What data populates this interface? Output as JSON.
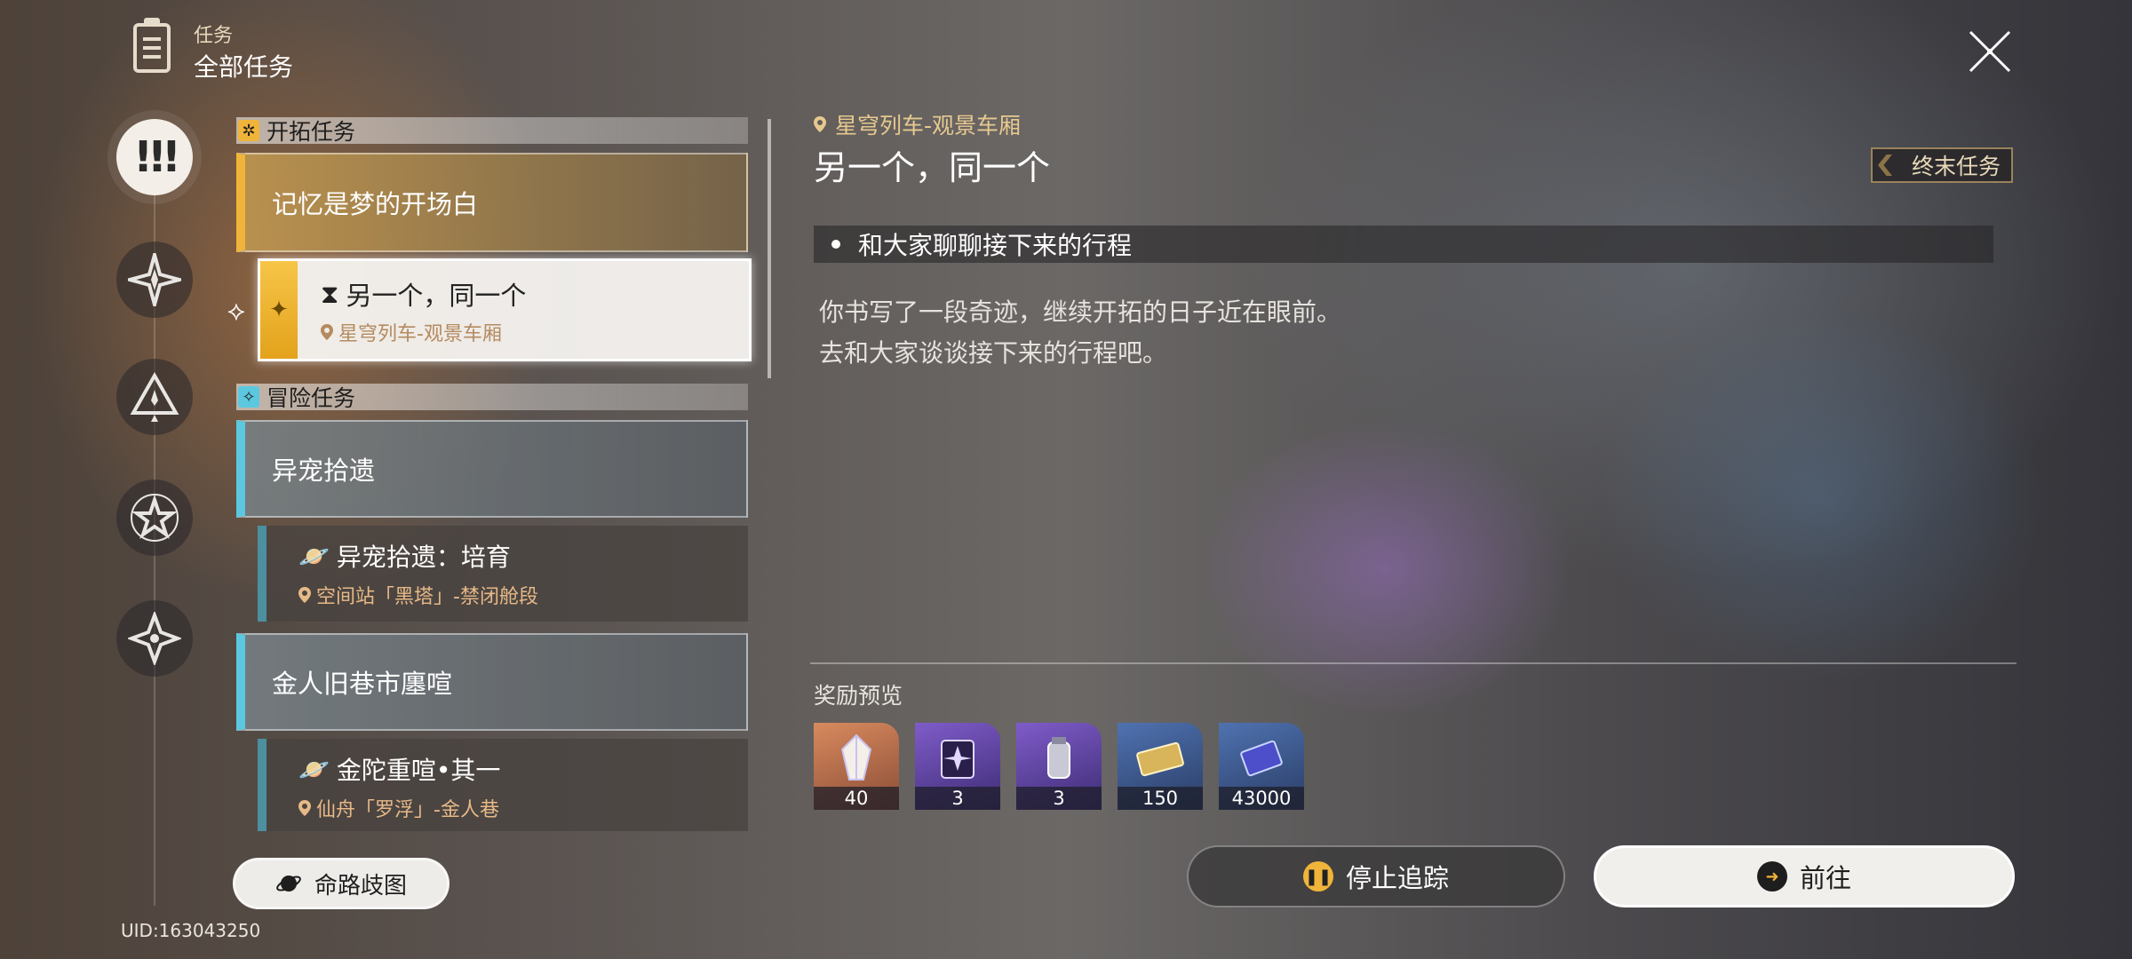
{
  "header": {
    "category": "任务",
    "title": "全部任务"
  },
  "rail": {
    "active_label": "!!!",
    "icons": [
      "diamond-star-icon",
      "triangle-star-icon",
      "star-icon",
      "sparkle-icon"
    ]
  },
  "sections": {
    "trailblaze": {
      "label": "开拓任务"
    },
    "adventure": {
      "label": "冒险任务"
    }
  },
  "quests": {
    "q1_title": "记忆是梦的开场白",
    "q1_sub_title": "另一个，同一个",
    "q1_sub_location": "星穹列车-观景车厢",
    "q2_title": "异宠拾遗",
    "q2_sub_title": "异宠拾遗：培育",
    "q2_sub_location": "空间站「黑塔」-禁闭舱段",
    "q3_title": "金人旧巷市廛喧",
    "q3_sub_title": "金陀重喧•其一",
    "q3_sub_location": "仙舟「罗浮」-金人巷"
  },
  "bottom_left": {
    "route_button": "命路歧图",
    "uid": "UID:163043250"
  },
  "detail": {
    "location": "星穹列车-观景车厢",
    "title": "另一个，同一个",
    "tag": "终末任务",
    "objective": "和大家聊聊接下来的行程",
    "description_line1": "你书写了一段奇迹，继续开拓的日子近在眼前。",
    "description_line2": "去和大家谈谈接下来的行程吧。",
    "rewards_label": "奖励预览",
    "rewards": [
      {
        "count": "40",
        "bg": "#c77a55"
      },
      {
        "count": "3",
        "bg": "#6a4fa8"
      },
      {
        "count": "3",
        "bg": "#6a4fa8"
      },
      {
        "count": "150",
        "bg": "#3f5f98"
      },
      {
        "count": "43000",
        "bg": "#3f5f98"
      }
    ],
    "stop_button": "停止追踪",
    "go_button": "前往"
  },
  "colors": {
    "gold_accent": "#f0b43a",
    "blue_accent": "#5cc8e0",
    "location_text": "#e7c98f"
  }
}
